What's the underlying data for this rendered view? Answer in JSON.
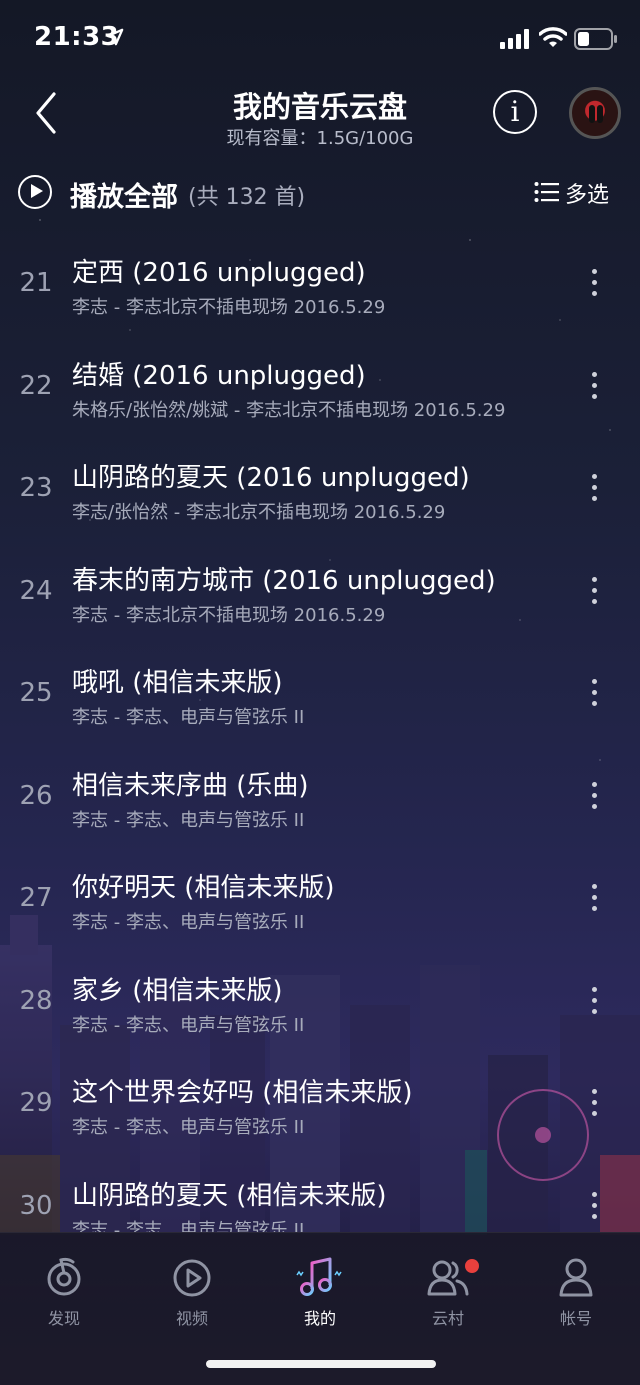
{
  "status_bar": {
    "time": "21:33"
  },
  "header": {
    "title": "我的音乐云盘",
    "capacity": "现有容量：1.5G/100G"
  },
  "playall": {
    "label": "播放全部",
    "count": "(共 132 首)",
    "multiselect": "多选"
  },
  "songs": [
    {
      "index": "21",
      "title": "定西 (2016 unplugged)",
      "meta": "李志 - 李志北京不插电现场 2016.5.29"
    },
    {
      "index": "22",
      "title": "结婚 (2016 unplugged)",
      "meta": "朱格乐/张怡然/姚斌 - 李志北京不插电现场 2016.5.29"
    },
    {
      "index": "23",
      "title": "山阴路的夏天 (2016 unplugged)",
      "meta": "李志/张怡然 - 李志北京不插电现场 2016.5.29"
    },
    {
      "index": "24",
      "title": "春末的南方城市 (2016 unplugged)",
      "meta": "李志 - 李志北京不插电现场 2016.5.29"
    },
    {
      "index": "25",
      "title": "哦吼 (相信未来版)",
      "meta": "李志 - 李志、电声与管弦乐 II"
    },
    {
      "index": "26",
      "title": "相信未来序曲 (乐曲)",
      "meta": "李志 - 李志、电声与管弦乐 II"
    },
    {
      "index": "27",
      "title": "你好明天 (相信未来版)",
      "meta": "李志 - 李志、电声与管弦乐 II"
    },
    {
      "index": "28",
      "title": "家乡 (相信未来版)",
      "meta": "李志 - 李志、电声与管弦乐 II"
    },
    {
      "index": "29",
      "title": "这个世界会好吗 (相信未来版)",
      "meta": "李志 - 李志、电声与管弦乐 II"
    },
    {
      "index": "30",
      "title": "山阴路的夏天 (相信未来版)",
      "meta": "李志 - 李志、电声与管弦乐 II"
    }
  ],
  "tabs": [
    {
      "label": "发现",
      "icon": "discover-icon"
    },
    {
      "label": "视频",
      "icon": "video-icon"
    },
    {
      "label": "我的",
      "icon": "music-note-icon",
      "active": true
    },
    {
      "label": "云村",
      "icon": "community-icon",
      "badge": true
    },
    {
      "label": "帐号",
      "icon": "account-icon"
    }
  ],
  "colors": {
    "accent": "#e8403d",
    "active_tab_gradient": [
      "#f25ac3",
      "#6ad0ff"
    ]
  }
}
